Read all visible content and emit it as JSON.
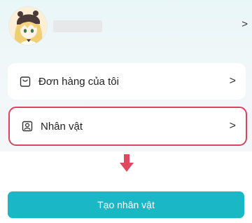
{
  "profile": {
    "chevron": ">",
    "avatar_icon": "anime-girl-avatar"
  },
  "menu": {
    "orders_label": "Đơn hàng của tôi",
    "orders_icon": "shopping-bag-icon",
    "character_label": "Nhân vật",
    "character_icon": "person-card-icon",
    "chevron": ">"
  },
  "action": {
    "create_label": "Tạo nhân vật"
  },
  "colors": {
    "highlight": "#d9445e",
    "arrow": "#e0485f",
    "button": "#1ab7c7"
  }
}
